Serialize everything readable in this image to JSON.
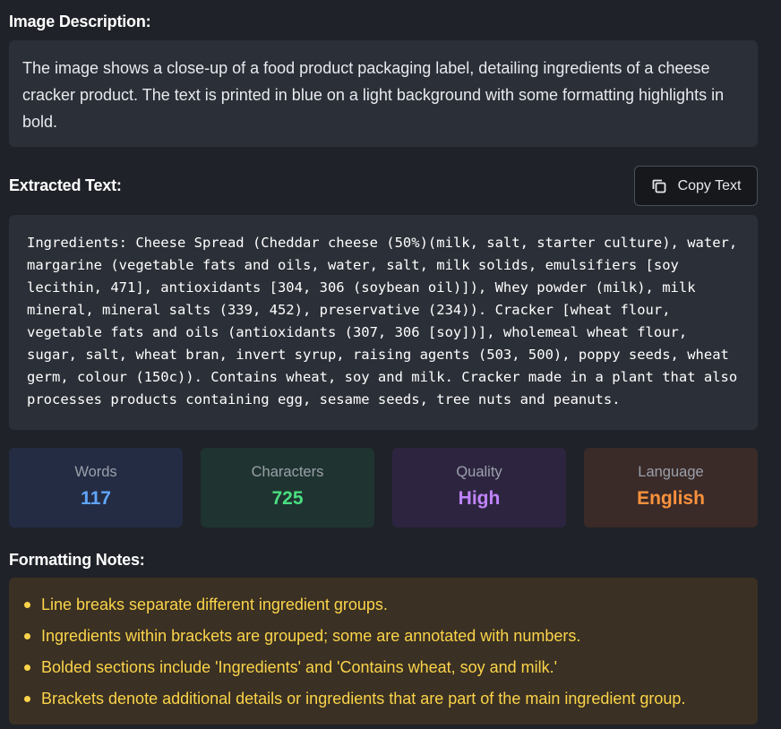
{
  "description": {
    "heading": "Image Description:",
    "text": "The image shows a close-up of a food product packaging label, detailing ingredients of a cheese cracker product. The text is printed in blue on a light background with some formatting highlights in bold."
  },
  "extracted": {
    "heading": "Extracted Text:",
    "copy_label": "Copy Text",
    "copy_icon": "copy-icon",
    "text": "Ingredients: Cheese Spread (Cheddar cheese (50%)(milk, salt, starter culture), water, margarine (vegetable fats and oils, water, salt, milk solids, emulsifiers [soy lecithin, 471], antioxidants [304, 306 (soybean oil)]), Whey powder (milk), milk mineral, mineral salts (339, 452), preservative (234)). Cracker [wheat flour, vegetable fats and oils (antioxidants (307, 306 [soy])], wholemeal wheat flour, sugar, salt, wheat bran, invert syrup, raising agents (503, 500), poppy seeds, wheat germ, colour (150c)). Contains wheat, soy and milk. Cracker made in a plant that also processes products containing egg, sesame seeds, tree nuts and peanuts."
  },
  "stats": {
    "words": {
      "label": "Words",
      "value": "117",
      "color": "#60a5fa"
    },
    "characters": {
      "label": "Characters",
      "value": "725",
      "color": "#4ade80"
    },
    "quality": {
      "label": "Quality",
      "value": "High",
      "color": "#c084fc"
    },
    "language": {
      "label": "Language",
      "value": "English",
      "color": "#fb923c"
    }
  },
  "notes": {
    "heading": "Formatting Notes:",
    "items": [
      "Line breaks separate different ingredient groups.",
      "Ingredients within brackets are grouped; some are annotated with numbers.",
      "Bolded sections include 'Ingredients' and 'Contains wheat, soy and milk.'",
      "Brackets denote additional details or ingredients that are part of the main ingredient group."
    ]
  }
}
